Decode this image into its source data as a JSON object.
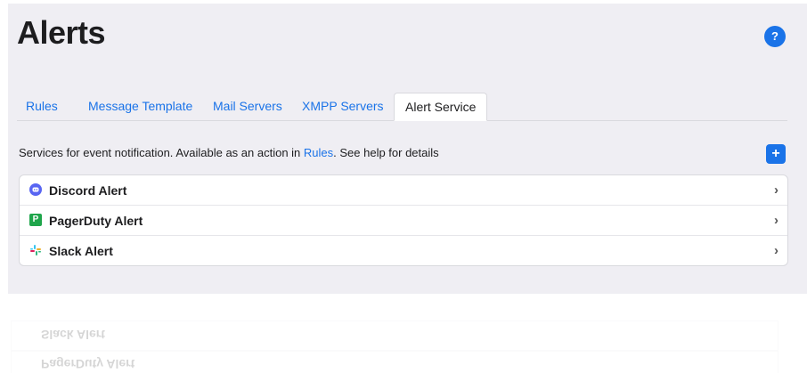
{
  "page": {
    "title": "Alerts",
    "help_label": "?"
  },
  "tabs": [
    {
      "label": "Rules",
      "active": false
    },
    {
      "label": "Message Template",
      "active": false
    },
    {
      "label": "Mail Servers",
      "active": false
    },
    {
      "label": "XMPP Servers",
      "active": false
    },
    {
      "label": "Alert Service",
      "active": true
    }
  ],
  "description": {
    "before": "Services for event notification. Available as an action in ",
    "link": "Rules",
    "after": ". See help for details"
  },
  "add_button_label": "+",
  "services": [
    {
      "label": "Discord Alert",
      "icon": "discord-icon",
      "chevron": "›"
    },
    {
      "label": "PagerDuty Alert",
      "icon": "pagerduty-icon",
      "chevron": "›",
      "icon_text": "P"
    },
    {
      "label": "Slack Alert",
      "icon": "slack-icon",
      "chevron": "›"
    }
  ],
  "reflection": [
    {
      "label": "Slack Alert"
    },
    {
      "label": "PagerDuty Alert"
    }
  ],
  "colors": {
    "accent": "#1a73e8",
    "discord": "#5865f2",
    "pagerduty": "#1fa54b"
  }
}
